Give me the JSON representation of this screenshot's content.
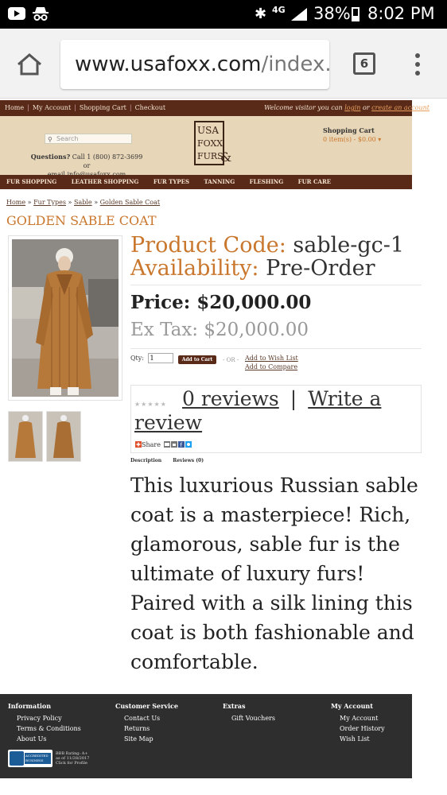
{
  "status_bar": {
    "network": "4G",
    "battery": "38%",
    "battery_level": 0.38,
    "time": "8:02 PM"
  },
  "browser": {
    "url_host": "www.usafoxx.com",
    "url_rest": "/index.",
    "tab_count": "6"
  },
  "top_nav": {
    "items": [
      "Home",
      "My Account",
      "Shopping Cart",
      "Checkout"
    ],
    "welcome_prefix": "Welcome visitor you can ",
    "login": "login",
    "or": " or ",
    "create": "create an account"
  },
  "header": {
    "search_placeholder": "Search",
    "questions_label": "Questions?",
    "questions_phone": " Call 1 (800) 872-3699 or",
    "questions_email": "email info@usafoxx.com",
    "logo_lines": [
      "USA",
      "FOXX",
      "FURS",
      "&"
    ],
    "cart_title": "Shopping Cart",
    "cart_value": "0 item(s) - $0.00"
  },
  "category_nav": [
    "FUR SHOPPING",
    "LEATHER SHOPPING",
    "FUR TYPES",
    "TANNING",
    "FLESHING",
    "FUR CARE"
  ],
  "breadcrumb": [
    "Home",
    "Fur Types",
    "Sable",
    "Golden Sable Coat"
  ],
  "breadcrumb_sep": " » ",
  "product": {
    "title": "GOLDEN SABLE COAT",
    "code_label": "Product Code:",
    "code": " sable-gc-1",
    "availability_label": "Availability:",
    "availability": " Pre-Order",
    "price": "Price: $20,000.00",
    "ex_tax": "Ex Tax: $20,000.00",
    "qty_label": "Qty:",
    "qty_value": "1",
    "add_to_cart": "Add to Cart",
    "or": "- OR -",
    "wish_list": "Add to Wish List",
    "compare": "Add to Compare",
    "reviews_count": "0 reviews",
    "write_review": "Write a review",
    "rating": 0,
    "share": "Share",
    "tab_description": "Description",
    "tab_reviews": "Reviews (0)",
    "description": "This luxurious Russian sable coat is a masterpiece! Rich, glamorous, sable fur is the ultimate of luxury furs! Paired with a silk lining this coat is both fashionable and comfortable."
  },
  "footer": {
    "columns": [
      {
        "heading": "Information",
        "items": [
          "Privacy Policy",
          "Terms & Conditions",
          "About Us"
        ]
      },
      {
        "heading": "Customer Service",
        "items": [
          "Contact Us",
          "Returns",
          "Site Map"
        ]
      },
      {
        "heading": "Extras",
        "items": [
          "Gift Vouchers"
        ]
      },
      {
        "heading": "My Account",
        "items": [
          "My Account",
          "Order History",
          "Wish List"
        ]
      }
    ],
    "bbb_badge": "ACCREDITED BUSINESS",
    "bbb_rating": "BBB Rating: A+",
    "bbb_asof": "as of 11/28/2017",
    "bbb_click": "Click for Profile"
  },
  "colors": {
    "brown": "#5a2a18",
    "tan": "#e8d6b8",
    "accent_orange": "#c9772d",
    "footer_bg": "#2e2e2e"
  }
}
